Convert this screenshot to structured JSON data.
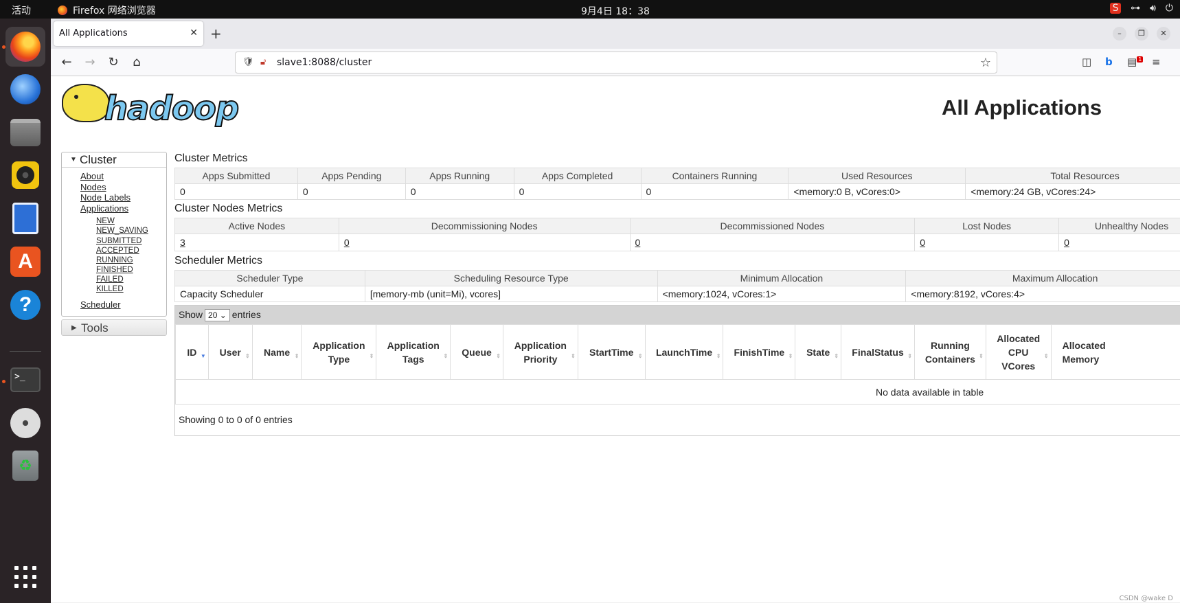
{
  "topbar": {
    "activities": "活动",
    "app_name": "Firefox 网络浏览器",
    "clock": "9月4日  18：38"
  },
  "dock": {
    "items": [
      "firefox-icon",
      "thunderbird-icon",
      "files-icon",
      "rhythmbox-icon",
      "writer-icon",
      "app-center-icon",
      "help-icon",
      "terminal-icon",
      "dvd-icon",
      "trash-icon",
      "show-apps-icon"
    ]
  },
  "browser": {
    "tab_title": "All Applications",
    "url": "slave1:8088/cluster",
    "badge": "1"
  },
  "page": {
    "title": "All Applications",
    "logo_text": "hadoop"
  },
  "sidebar": {
    "cluster_label": "Cluster",
    "tools_label": "Tools",
    "links": [
      "About",
      "Nodes",
      "Node Labels",
      "Applications"
    ],
    "states": [
      "NEW",
      "NEW_SAVING",
      "SUBMITTED",
      "ACCEPTED",
      "RUNNING",
      "FINISHED",
      "FAILED",
      "KILLED"
    ],
    "scheduler": "Scheduler"
  },
  "cluster_metrics": {
    "title": "Cluster Metrics",
    "headers": [
      "Apps Submitted",
      "Apps Pending",
      "Apps Running",
      "Apps Completed",
      "Containers Running",
      "Used Resources",
      "Total Resources"
    ],
    "values": [
      "0",
      "0",
      "0",
      "0",
      "0",
      "<memory:0 B, vCores:0>",
      "<memory:24 GB, vCores:24>"
    ]
  },
  "nodes_metrics": {
    "title": "Cluster Nodes Metrics",
    "headers": [
      "Active Nodes",
      "Decommissioning Nodes",
      "Decommissioned Nodes",
      "Lost Nodes",
      "Unhealthy Nodes"
    ],
    "values": [
      "3",
      "0",
      "0",
      "0",
      "0"
    ]
  },
  "scheduler_metrics": {
    "title": "Scheduler Metrics",
    "headers": [
      "Scheduler Type",
      "Scheduling Resource Type",
      "Minimum Allocation",
      "Maximum Allocation"
    ],
    "values": [
      "Capacity Scheduler",
      "[memory-mb (unit=Mi), vcores]",
      "<memory:1024, vCores:1>",
      "<memory:8192, vCores:4>"
    ]
  },
  "apps_table": {
    "show_label": "Show",
    "page_size": "20",
    "entries_label": "entries",
    "columns": [
      [
        "ID"
      ],
      [
        "User"
      ],
      [
        "Name"
      ],
      [
        "Application",
        "Type"
      ],
      [
        "Application",
        "Tags"
      ],
      [
        "Queue"
      ],
      [
        "Application",
        "Priority"
      ],
      [
        "StartTime"
      ],
      [
        "LaunchTime"
      ],
      [
        "FinishTime"
      ],
      [
        "State"
      ],
      [
        "FinalStatus"
      ],
      [
        "Running",
        "Containers"
      ],
      [
        "Allocated",
        "CPU",
        "VCores"
      ],
      [
        "Allocated",
        "Memory"
      ]
    ],
    "empty_text": "No data available in table",
    "info_text": "Showing 0 to 0 of 0 entries"
  },
  "watermark": "CSDN @wake D"
}
